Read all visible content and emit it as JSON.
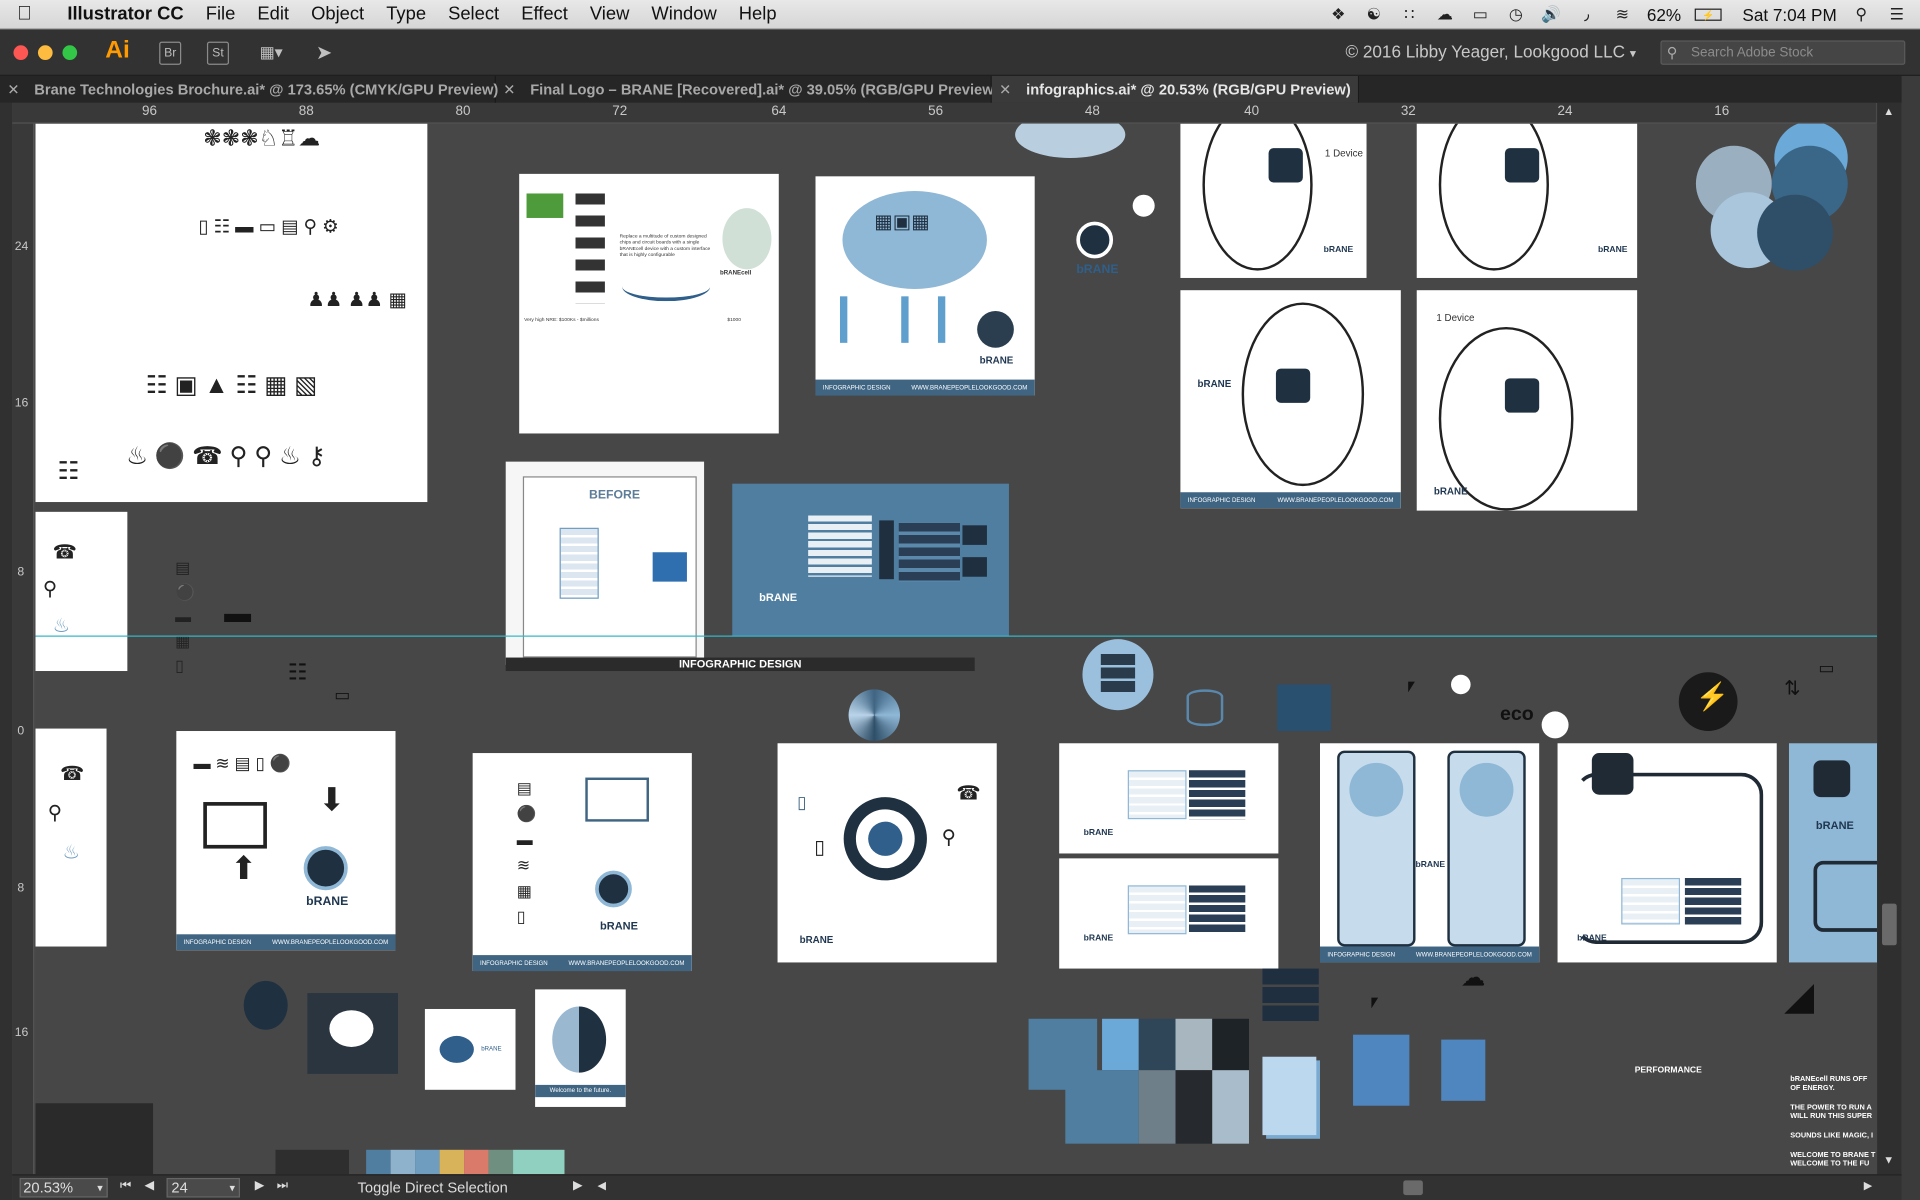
{
  "menubar": {
    "app_name": "Illustrator CC",
    "items": [
      "File",
      "Edit",
      "Object",
      "Type",
      "Select",
      "Effect",
      "View",
      "Window",
      "Help"
    ],
    "battery": "62%",
    "clock": "Sat 7:04 PM"
  },
  "appbar": {
    "logo": "Ai",
    "bridge_label": "Br",
    "stock_label": "St",
    "copyright": "© 2016 Libby Yeager, Lookgood LLC",
    "search_placeholder": "Search Adobe Stock"
  },
  "tabs": [
    {
      "label": "Brane Technologies Brochure.ai* @ 173.65% (CMYK/GPU Preview)",
      "active": false
    },
    {
      "label": "Final Logo – BRANE [Recovered].ai* @ 39.05% (RGB/GPU Preview)",
      "active": false
    },
    {
      "label": "infographics.ai* @ 20.53% (RGB/GPU Preview)",
      "active": true
    }
  ],
  "ruler": {
    "h_ticks": [
      "96",
      "88",
      "80",
      "72",
      "64",
      "56",
      "48",
      "40",
      "32",
      "24",
      "16"
    ],
    "v_ticks": [
      "24",
      "16",
      "8",
      "0",
      "8",
      "16"
    ]
  },
  "canvas": {
    "before_label": "BEFORE",
    "infographic_banner": "INFOGRAPHIC DESIGN",
    "footer_label": "INFOGRAPHIC DESIGN",
    "footer_url": "WWW.BRANEPEOPLELOOKGOOD.COM",
    "one_device": "1 Device",
    "brane": "bRANE",
    "technologies": "TECHNOLOGIES",
    "nre_text": "Very high NRE: $100Ks - $millions",
    "nre_price": "$1000",
    "branecell": "bRANEcell",
    "welcome": "Welcome to the future.",
    "performance": "PERFORMANCE",
    "eco": "eco",
    "side_copy": [
      "bRANEcell RUNS OFF",
      "OF ENERGY.",
      "THE POWER TO RUN A",
      "WILL RUN THIS SUPER",
      "SOUNDS LIKE MAGIC, I",
      "WELCOME TO BRANE T",
      "WELCOME TO THE FU"
    ],
    "desc_text": "Replace a multitude of custom designed chips and circuit boards with a single bRANEcell device with a custom interface that is highly configurable"
  },
  "palette": [
    "#4f7ea0",
    "#8fb2cc",
    "#6f9dc0",
    "#d9b35a",
    "#d97a6a",
    "#6f8f80",
    "#8fd0c0"
  ],
  "status": {
    "zoom": "20.53%",
    "artboard": "24",
    "tool": "Toggle Direct Selection"
  }
}
